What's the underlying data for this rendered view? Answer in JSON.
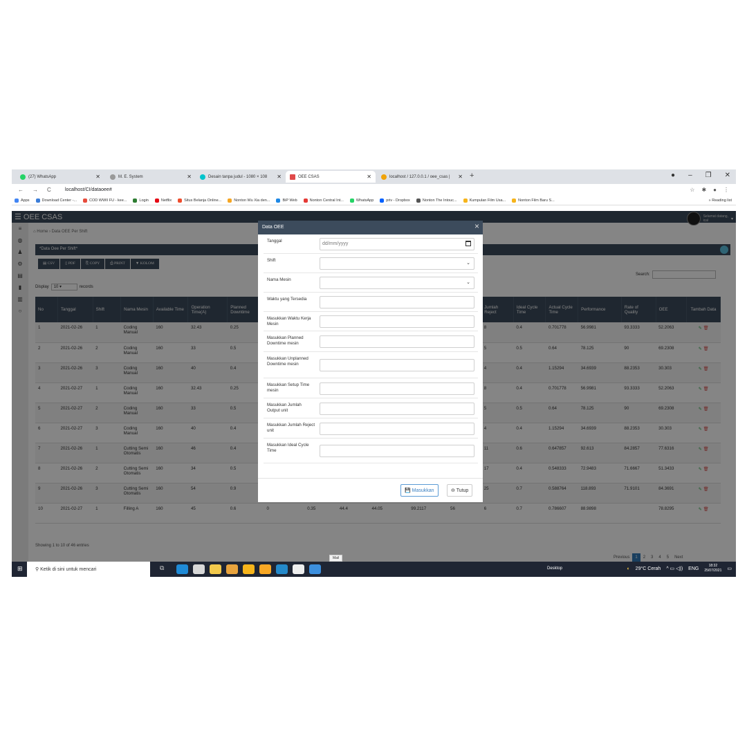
{
  "browser": {
    "tabs": [
      {
        "label": "(27) WhatsApp",
        "color": "#25d366"
      },
      {
        "label": "M. E. System",
        "color": "#999999"
      },
      {
        "label": "Desain tanpa judul - 1080 × 108",
        "color": "#00c4cc"
      },
      {
        "label": "OEE CSAS",
        "color": "#e04a4a"
      },
      {
        "label": "localhost / 127.0.0.1 / oee_csas |",
        "color": "#f0a30a"
      }
    ],
    "new_tab": "+",
    "url": "localhost/CI/dataoee#",
    "bookmarks": [
      "Apps",
      "Download Center -...",
      "COD WWII FU - kee...",
      "Login",
      "Netflix",
      "Situs Belanja Online...",
      "Nonton Wu Xia den...",
      "BiP Web",
      "Nonton Central Int...",
      "WhatsApp",
      "priv - Dropbox",
      "Nonton The Intouc...",
      "Kumpulan Film Usa...",
      "Nonton Film Baru S..."
    ],
    "bookmarks_right": "»  Reading list"
  },
  "app": {
    "brand": "OEE CSAS",
    "greeting": "Selamat datang,",
    "username": "ical",
    "breadcrumb_home": "Home",
    "breadcrumb_sep": "›",
    "breadcrumb_current": "Data OEE Per Shift",
    "panel_title": "*Data Oee Per Shift*",
    "export_buttons": [
      "CSV",
      "PDF",
      "COPY",
      "PRINT",
      "KOLOM"
    ],
    "display_label": "Display",
    "display_value": "10",
    "records_label": "records",
    "search_label": "Search:",
    "columns": [
      "No",
      "Tanggal",
      "Shift",
      "Nama Mesin",
      "Available Time",
      "Operation Time(A)",
      "Planned Downtime",
      "",
      "",
      "",
      "",
      "",
      "",
      "Jumlah Reject",
      "Ideal Cycle Time",
      "Actual Cycle Time",
      "Performance",
      "Rate of Quality",
      "OEE",
      "Tambah Data"
    ],
    "rows": [
      [
        "1",
        "2021-02-26",
        "1",
        "Coding Manual",
        "160",
        "32.43",
        "0.25",
        "",
        "",
        "",
        "",
        "",
        "",
        "8",
        "0.4",
        "0.701778",
        "56.9981",
        "93.3333",
        "52.2063"
      ],
      [
        "2",
        "2021-02-26",
        "2",
        "Coding Manual",
        "160",
        "33",
        "0.5",
        "",
        "",
        "",
        "",
        "",
        "",
        "5",
        "0.5",
        "0.64",
        "78.125",
        "90",
        "69.2308"
      ],
      [
        "3",
        "2021-02-26",
        "3",
        "Coding Manual",
        "160",
        "40",
        "0.4",
        "",
        "",
        "",
        "",
        "",
        "",
        "4",
        "0.4",
        "1.15294",
        "34.6939",
        "88.2353",
        "30.303"
      ],
      [
        "4",
        "2021-02-27",
        "1",
        "Coding Manual",
        "160",
        "32.43",
        "0.25",
        "",
        "",
        "",
        "",
        "",
        "",
        "8",
        "0.4",
        "0.701778",
        "56.9981",
        "93.3333",
        "52.2063"
      ],
      [
        "5",
        "2021-02-27",
        "2",
        "Coding Manual",
        "160",
        "33",
        "0.5",
        "",
        "",
        "",
        "",
        "",
        "",
        "5",
        "0.5",
        "0.64",
        "78.125",
        "90",
        "69.2308"
      ],
      [
        "6",
        "2021-02-27",
        "3",
        "Coding Manual",
        "160",
        "40",
        "0.4",
        "",
        "",
        "",
        "",
        "",
        "",
        "4",
        "0.4",
        "1.15294",
        "34.6939",
        "88.2353",
        "30.303"
      ],
      [
        "7",
        "2021-02-26",
        "1",
        "Cutting Semi Otomatis",
        "160",
        "46",
        "0.4",
        "",
        "",
        "",
        "",
        "",
        "",
        "11",
        "0.6",
        "0.647857",
        "92.613",
        "84.2857",
        "77.6316"
      ],
      [
        "8",
        "2021-02-26",
        "2",
        "Cutting Semi Otomatis",
        "160",
        "34",
        "0.5",
        "",
        "",
        "",
        "",
        "",
        "",
        "17",
        "0.4",
        "0.548333",
        "72.9483",
        "71.6667",
        "51.3433"
      ],
      [
        "9",
        "2021-02-26",
        "3",
        "Cutting Semi Otomatis",
        "160",
        "54",
        "0.9",
        "0",
        "0.7",
        "53.1",
        "52.4",
        "98.6817",
        "89",
        "25",
        "0.7",
        "0.588764",
        "118.893",
        "71.9101",
        "84.3691"
      ],
      [
        "10",
        "2021-02-27",
        "1",
        "Filling A",
        "160",
        "45",
        "0.6",
        "0",
        "0.35",
        "44.4",
        "44.05",
        "99.2117",
        "56",
        "6",
        "0.7",
        "0.786607",
        "88.9898",
        "",
        "78.8295"
      ]
    ],
    "showing": "Showing 1 to 10 of 46 entries",
    "pager": [
      "Previous",
      "1",
      "2",
      "3",
      "4",
      "5",
      "Next"
    ],
    "watermark": "Activate Windows",
    "watermark_sub": "Go to Settings to activate Windows."
  },
  "modal": {
    "title": "Data OEE",
    "close": "×",
    "fields": [
      {
        "label": "Tanggal",
        "placeholder": "dd/mm/yyyy",
        "type": "date"
      },
      {
        "label": "Shift",
        "placeholder": "",
        "type": "select"
      },
      {
        "label": "Nama Mesin",
        "placeholder": "",
        "type": "select"
      },
      {
        "label": "Waktu yang Tersedia",
        "placeholder": "",
        "type": "text"
      },
      {
        "label": "Masukkan Waktu Kerja Mesin",
        "placeholder": "",
        "type": "text"
      },
      {
        "label": "Masukkan Planned Downtime mesin",
        "placeholder": "",
        "type": "text"
      },
      {
        "label": "Masukkan Unplanned Downtime mesin",
        "placeholder": "",
        "type": "text"
      },
      {
        "label": "Masukkan Setup Time mesin",
        "placeholder": "",
        "type": "text"
      },
      {
        "label": "Masukkan Jumlah Output unit",
        "placeholder": "",
        "type": "text"
      },
      {
        "label": "Masukkan Jumlah Reject unit",
        "placeholder": "",
        "type": "text"
      },
      {
        "label": "Masukkan Ideal Cycle Time",
        "placeholder": "",
        "type": "text"
      }
    ],
    "submit": "Masukkan",
    "cancel": "Tutup"
  },
  "taskbar": {
    "search_placeholder": "Ketik di sini untuk mencari",
    "mail_tooltip": "Mail",
    "desktop": "Desktop",
    "weather": "29°C Cerah",
    "lang": "ENG",
    "time": "18:32",
    "date": "25/07/2021"
  }
}
